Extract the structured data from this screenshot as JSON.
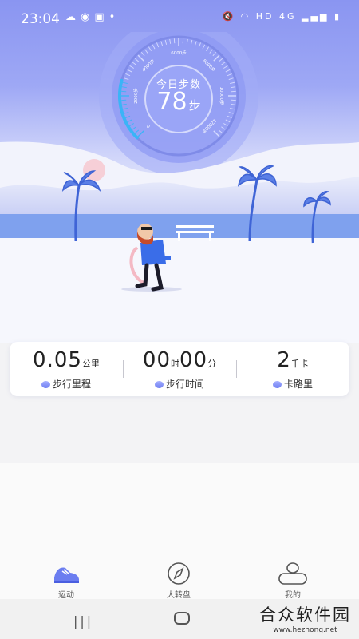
{
  "status_bar": {
    "time": "23:04",
    "network_label": "HD",
    "signal_label": "4G"
  },
  "dial": {
    "title": "今日步数",
    "steps": "78",
    "unit": "步",
    "ticks": [
      "0",
      "2000步",
      "4000步",
      "6000步",
      "8000步",
      "10000步",
      "12000步"
    ],
    "accent_color": "#3ab4f7"
  },
  "stats": [
    {
      "value": "0.05",
      "unit": "公里",
      "label": "步行里程",
      "icon": "shoe-icon"
    },
    {
      "value1": "00",
      "unit1": "时",
      "value2": "00",
      "unit2": "分",
      "label": "步行时间",
      "icon": "clock-icon"
    },
    {
      "value": "2",
      "unit": "千卡",
      "label": "卡路里",
      "icon": "flame-icon"
    }
  ],
  "tabs": [
    {
      "label": "运动",
      "icon": "sneaker-icon",
      "active": true
    },
    {
      "label": "大转盘",
      "icon": "compass-icon",
      "active": false
    },
    {
      "label": "我的",
      "icon": "profile-icon",
      "active": false
    }
  ],
  "watermark": {
    "title": "合众软件园",
    "url": "www.hezhong.net"
  }
}
